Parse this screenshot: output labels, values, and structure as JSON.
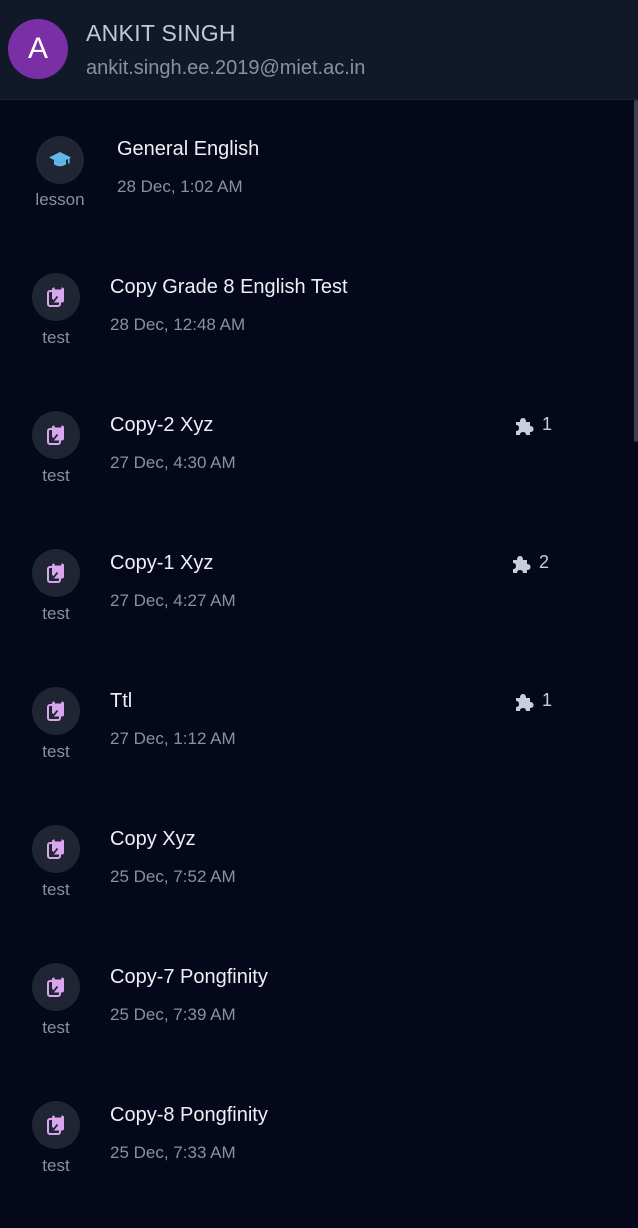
{
  "user": {
    "initial": "A",
    "name": "ANKIT SINGH",
    "email": "ankit.singh.ee.2019@miet.ac.in"
  },
  "items": [
    {
      "type": "lesson",
      "icon": "graduation-cap-icon",
      "title": "General English",
      "date": "28 Dec, 1:02 AM",
      "puzzle_count": null
    },
    {
      "type": "test",
      "icon": "clipboard-check-icon",
      "title": "Copy Grade 8 English Test",
      "date": "28 Dec, 12:48 AM",
      "puzzle_count": null
    },
    {
      "type": "test",
      "icon": "clipboard-check-icon",
      "title": "Copy-2 Xyz",
      "date": "27 Dec, 4:30 AM",
      "puzzle_count": "1"
    },
    {
      "type": "test",
      "icon": "clipboard-check-icon",
      "title": "Copy-1 Xyz",
      "date": "27 Dec, 4:27 AM",
      "puzzle_count": "2"
    },
    {
      "type": "test",
      "icon": "clipboard-check-icon",
      "title": "Ttl",
      "date": "27 Dec, 1:12 AM",
      "puzzle_count": "1"
    },
    {
      "type": "test",
      "icon": "clipboard-check-icon",
      "title": "Copy Xyz",
      "date": "25 Dec, 7:52 AM",
      "puzzle_count": null
    },
    {
      "type": "test",
      "icon": "clipboard-check-icon",
      "title": "Copy-7 Pongfinity",
      "date": "25 Dec, 7:39 AM",
      "puzzle_count": null
    },
    {
      "type": "test",
      "icon": "clipboard-check-icon",
      "title": "Copy-8 Pongfinity",
      "date": "25 Dec, 7:33 AM",
      "puzzle_count": null
    }
  ],
  "colors": {
    "background": "#04081a",
    "header": "#111827",
    "avatar": "#7a2fa6",
    "lesson_icon": "#5fb8e8",
    "test_icon": "#d7a6ef"
  }
}
